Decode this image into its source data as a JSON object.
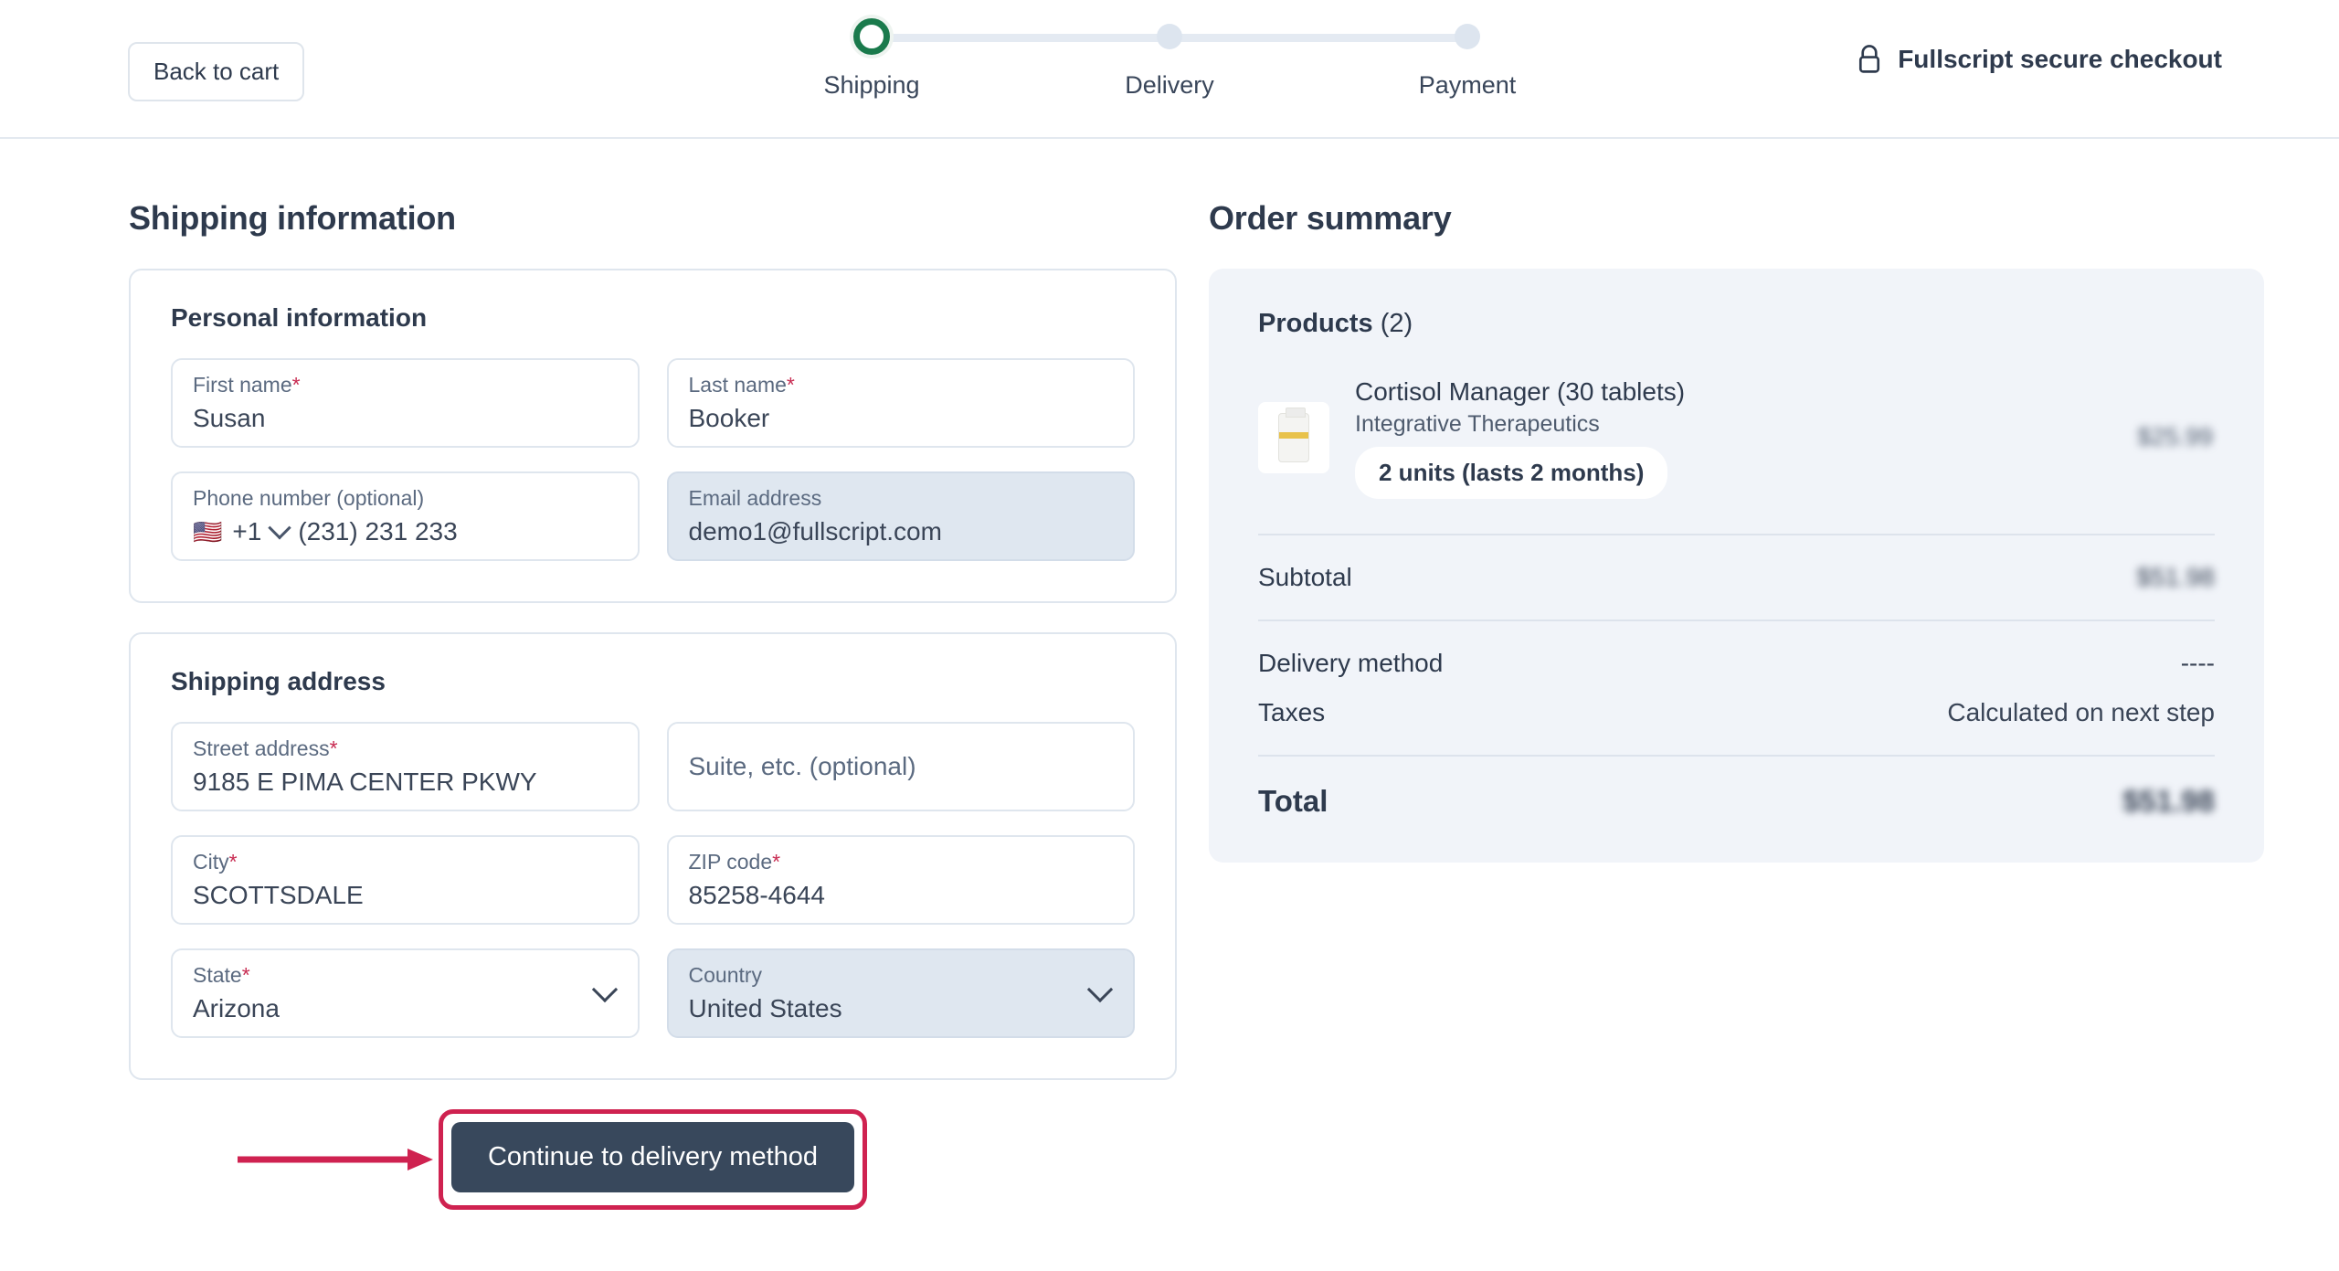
{
  "header": {
    "back_label": "Back to cart",
    "secure_label": "Fullscript secure checkout",
    "lock_icon": "lock-icon",
    "steps": [
      {
        "label": "Shipping",
        "state": "active"
      },
      {
        "label": "Delivery",
        "state": "upcoming"
      },
      {
        "label": "Payment",
        "state": "upcoming"
      }
    ]
  },
  "shipping": {
    "title": "Shipping information",
    "personal": {
      "card_title": "Personal information",
      "first_name": {
        "label": "First name",
        "required": "*",
        "value": "Susan"
      },
      "last_name": {
        "label": "Last name",
        "required": "*",
        "value": "Booker"
      },
      "phone": {
        "label": "Phone number (optional)",
        "flag": "us-flag-icon",
        "country_code": "+1",
        "value": "(231) 231 233"
      },
      "email": {
        "label": "Email address",
        "value": "demo1@fullscript.com",
        "disabled": true
      }
    },
    "address": {
      "card_title": "Shipping address",
      "street": {
        "label": "Street address",
        "required": "*",
        "value": "9185 E PIMA CENTER PKWY"
      },
      "suite": {
        "placeholder": "Suite, etc. (optional)",
        "value": ""
      },
      "city": {
        "label": "City",
        "required": "*",
        "value": "SCOTTSDALE"
      },
      "zip": {
        "label": "ZIP code",
        "required": "*",
        "value": "85258-4644"
      },
      "state": {
        "label": "State",
        "required": "*",
        "value": "Arizona"
      },
      "country": {
        "label": "Country",
        "value": "United States",
        "disabled": true
      }
    },
    "continue_label": "Continue to delivery method"
  },
  "summary": {
    "title": "Order summary",
    "products_label": "Products",
    "products_count": "(2)",
    "items": [
      {
        "name": "Cortisol Manager (30 tablets)",
        "brand": "Integrative Therapeutics",
        "units_badge": "2 units (lasts 2 months)",
        "price": "$25.99"
      }
    ],
    "subtotal_label": "Subtotal",
    "subtotal_value": "$51.98",
    "delivery_label": "Delivery method",
    "delivery_value": "----",
    "taxes_label": "Taxes",
    "taxes_value": "Calculated on next step",
    "total_label": "Total",
    "total_value": "$51.98"
  },
  "annotation": {
    "arrow_color": "#cf2250",
    "highlight_color": "#cf2250"
  }
}
